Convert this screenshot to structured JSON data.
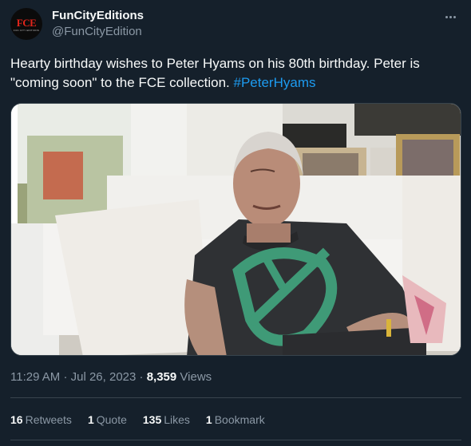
{
  "author": {
    "display_name": "FunCityEditions",
    "handle": "@FunCityEdition",
    "avatar_text": "FCE",
    "avatar_subtext": "FUN CITY EDITIONS"
  },
  "tweet": {
    "text_before": "Hearty birthday wishes to Peter Hyams on his 80th birthday. Peter is \"coming soon\" to the FCE collection.",
    "hashtag": "#PeterHyams",
    "media_icon": "photo-of-older-man-on-sofa"
  },
  "meta": {
    "time": "11:29 AM",
    "separator1": "·",
    "date": "Jul 26, 2023",
    "separator2": "·",
    "views_count": "8,359",
    "views_label": "Views"
  },
  "stats": {
    "retweets_count": "16",
    "retweets_label": "Retweets",
    "quotes_count": "1",
    "quotes_label": "Quote",
    "likes_count": "135",
    "likes_label": "Likes",
    "bookmarks_count": "1",
    "bookmarks_label": "Bookmark"
  },
  "colors": {
    "background": "#15202b",
    "text_primary": "#f7f9f9",
    "text_secondary": "#8b98a5",
    "link": "#1d9bf0",
    "divider": "#38444d"
  }
}
